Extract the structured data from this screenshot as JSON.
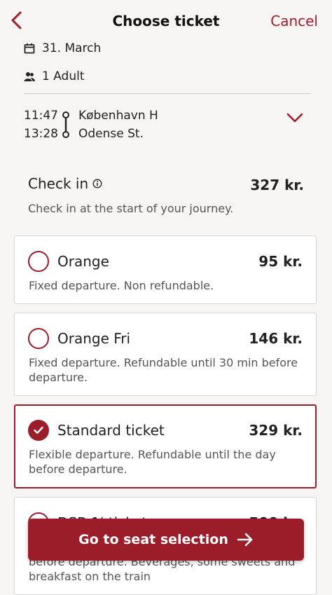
{
  "header": {
    "title": "Choose ticket",
    "cancel_label": "Cancel"
  },
  "trip": {
    "date": "31. March",
    "travellers": "1 Adult",
    "departure_time": "11:47",
    "arrival_time": "13:28",
    "from": "København H",
    "to": "Odense St."
  },
  "checkin": {
    "name": "Check in",
    "price": "327 kr.",
    "description": "Check in at the start of your journey."
  },
  "tickets": [
    {
      "name": "Orange",
      "price": "95 kr.",
      "description": "Fixed departure. Non refundable.",
      "selected": false
    },
    {
      "name": "Orange Fri",
      "price": "146 kr.",
      "description": "Fixed departure. Refundable until 30 min before departure.",
      "selected": false
    },
    {
      "name": "Standard ticket",
      "price": "329 kr.",
      "description": "Flexible departure. Refundable until the day before departure.",
      "selected": true
    },
    {
      "name": "DSB 1' ticket",
      "price": "500 kr.",
      "description": "Flexible departure. Refundable until the day before departure. Beverages, some sweets and breakfast on the train",
      "selected": false
    }
  ],
  "cta_label": "Go to seat selection",
  "colors": {
    "accent": "#9b1d2a",
    "background": "#f6f5f4",
    "card": "#ffffff"
  },
  "icons": {
    "back": "chevron-left-icon",
    "date": "calendar-icon",
    "travellers": "people-icon",
    "expand": "chevron-down-icon",
    "info": "info-icon",
    "check": "check-icon",
    "arrow": "arrow-right-icon"
  }
}
